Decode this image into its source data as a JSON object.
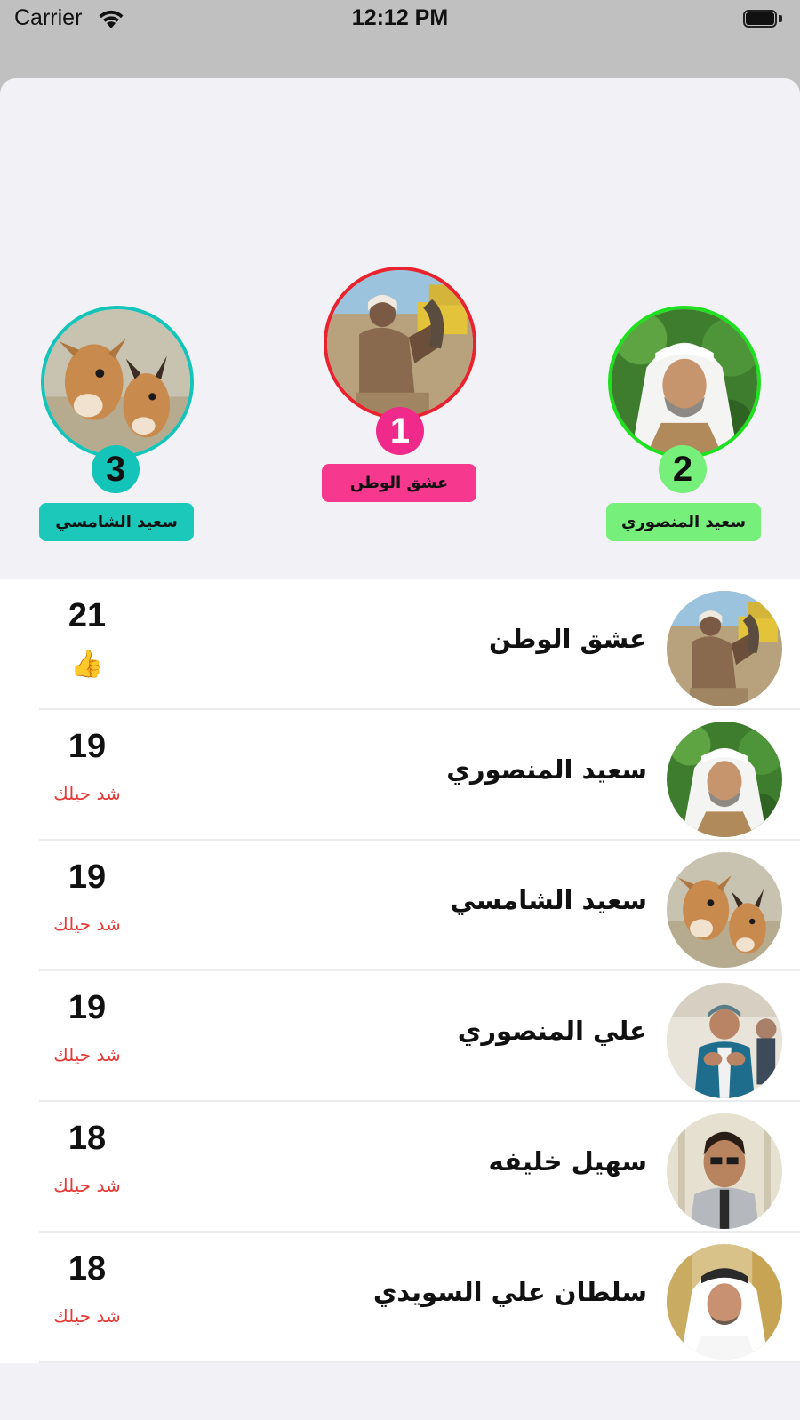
{
  "status_bar": {
    "carrier": "Carrier",
    "time": "12:12 PM"
  },
  "podium": {
    "first": {
      "rank": "1",
      "name": "عشق الوطن",
      "color": "#e4247a",
      "tag_color": "#f7388f"
    },
    "second": {
      "rank": "2",
      "name": "سعيد المنصوري",
      "color": "#1ee01e",
      "tag_color": "#77f07b"
    },
    "third": {
      "rank": "3",
      "name": "سعيد الشامسي",
      "color": "#14c4b8",
      "tag_color": "#1cc8ba"
    }
  },
  "rows": [
    {
      "name": "عشق الوطن",
      "score": "21",
      "status": "👍"
    },
    {
      "name": "سعيد المنصوري",
      "score": "19",
      "status": "شد حيلك"
    },
    {
      "name": "سعيد الشامسي",
      "score": "19",
      "status": "شد حيلك"
    },
    {
      "name": "علي المنصوري",
      "score": "19",
      "status": "شد حيلك"
    },
    {
      "name": "سهيل خليفه",
      "score": "18",
      "status": "شد حيلك"
    },
    {
      "name": "سلطان علي السويدي",
      "score": "18",
      "status": "شد حيلك"
    }
  ]
}
